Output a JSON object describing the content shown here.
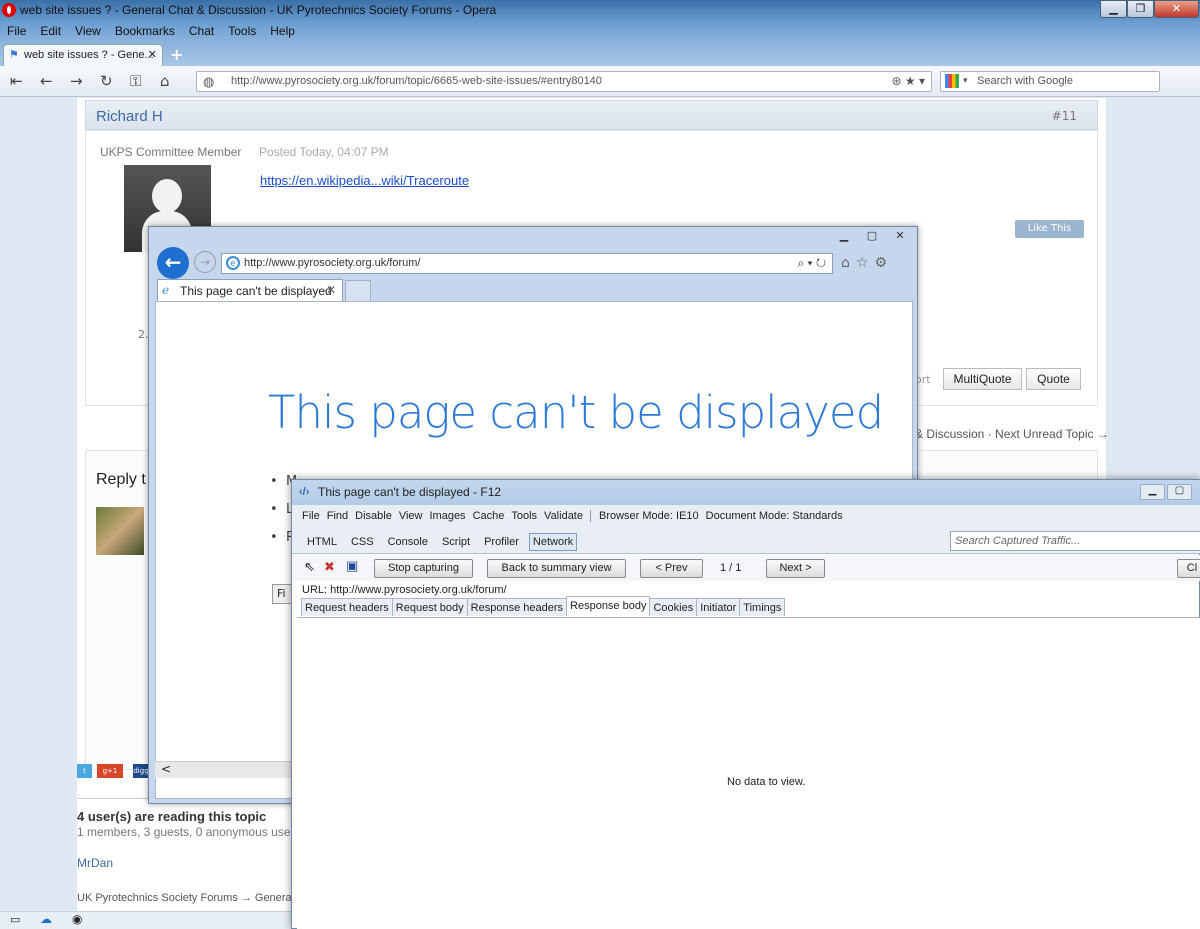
{
  "opera": {
    "window_title": "web site issues ? - General Chat & Discussion - UK Pyrotechnics Society Forums - Opera",
    "menu": [
      "File",
      "Edit",
      "View",
      "Bookmarks",
      "Chat",
      "Tools",
      "Help"
    ],
    "tab_label": "web site issues ? - Gene...",
    "new_tab": "+",
    "address": "http://www.pyrosociety.org.uk/forum/topic/6665-web-site-issues/#entry80140",
    "search_placeholder": "Search with Google",
    "win_min": "▁",
    "win_max": "❐",
    "win_close": "✕"
  },
  "forum": {
    "author": "Richard H",
    "post_number": "#11",
    "role": "UKPS Committee Member",
    "posted": "Posted Today, 04:07 PM",
    "link_text": "https://en.wikipedia...wiki/Traceroute",
    "like_label": "Like This",
    "multiquote_label": "MultiQuote",
    "quote_label": "Quote",
    "nav_links": "& Discussion · Next Unread Topic →",
    "reply_title": "Reply t",
    "users_title": "4 user(s) are reading this topic",
    "users_sub": "1 members, 3 guests, 0 anonymous user",
    "member": "MrDan",
    "breadcrumb": "UK Pyrotechnics Society Forums  →  General",
    "partial_text": "2.",
    "partial_port": "ort",
    "social": [
      "t",
      "g+1",
      "digg"
    ]
  },
  "ie": {
    "address": "http://www.pyrosociety.org.uk/forum/",
    "tab_label": "This page can't be displayed",
    "message": "This page can't be displayed",
    "bullets": [
      "M",
      "L",
      "R"
    ],
    "fix_label": "Fi",
    "scroll_left": "<"
  },
  "f12": {
    "title": "This page can't be displayed - F12",
    "menu": [
      "File",
      "Find",
      "Disable",
      "View",
      "Images",
      "Cache",
      "Tools",
      "Validate"
    ],
    "browser_mode": "Browser Mode: IE10",
    "document_mode": "Document Mode: Standards",
    "tabs": [
      "HTML",
      "CSS",
      "Console",
      "Script",
      "Profiler",
      "Network"
    ],
    "active_tab": "Network",
    "search_placeholder": "Search Captured Traffic...",
    "stop_label": "Stop capturing",
    "back_label": "Back to summary view",
    "prev_label": "< Prev",
    "page_count": "1 / 1",
    "next_label": "Next >",
    "clear_label": "Cl",
    "url": "URL: http://www.pyrosociety.org.uk/forum/",
    "detail_tabs": [
      "Request headers",
      "Request body",
      "Response headers",
      "Response body",
      "Cookies",
      "Initiator",
      "Timings"
    ],
    "active_detail_tab": "Response body",
    "empty_message": "No data to view."
  }
}
